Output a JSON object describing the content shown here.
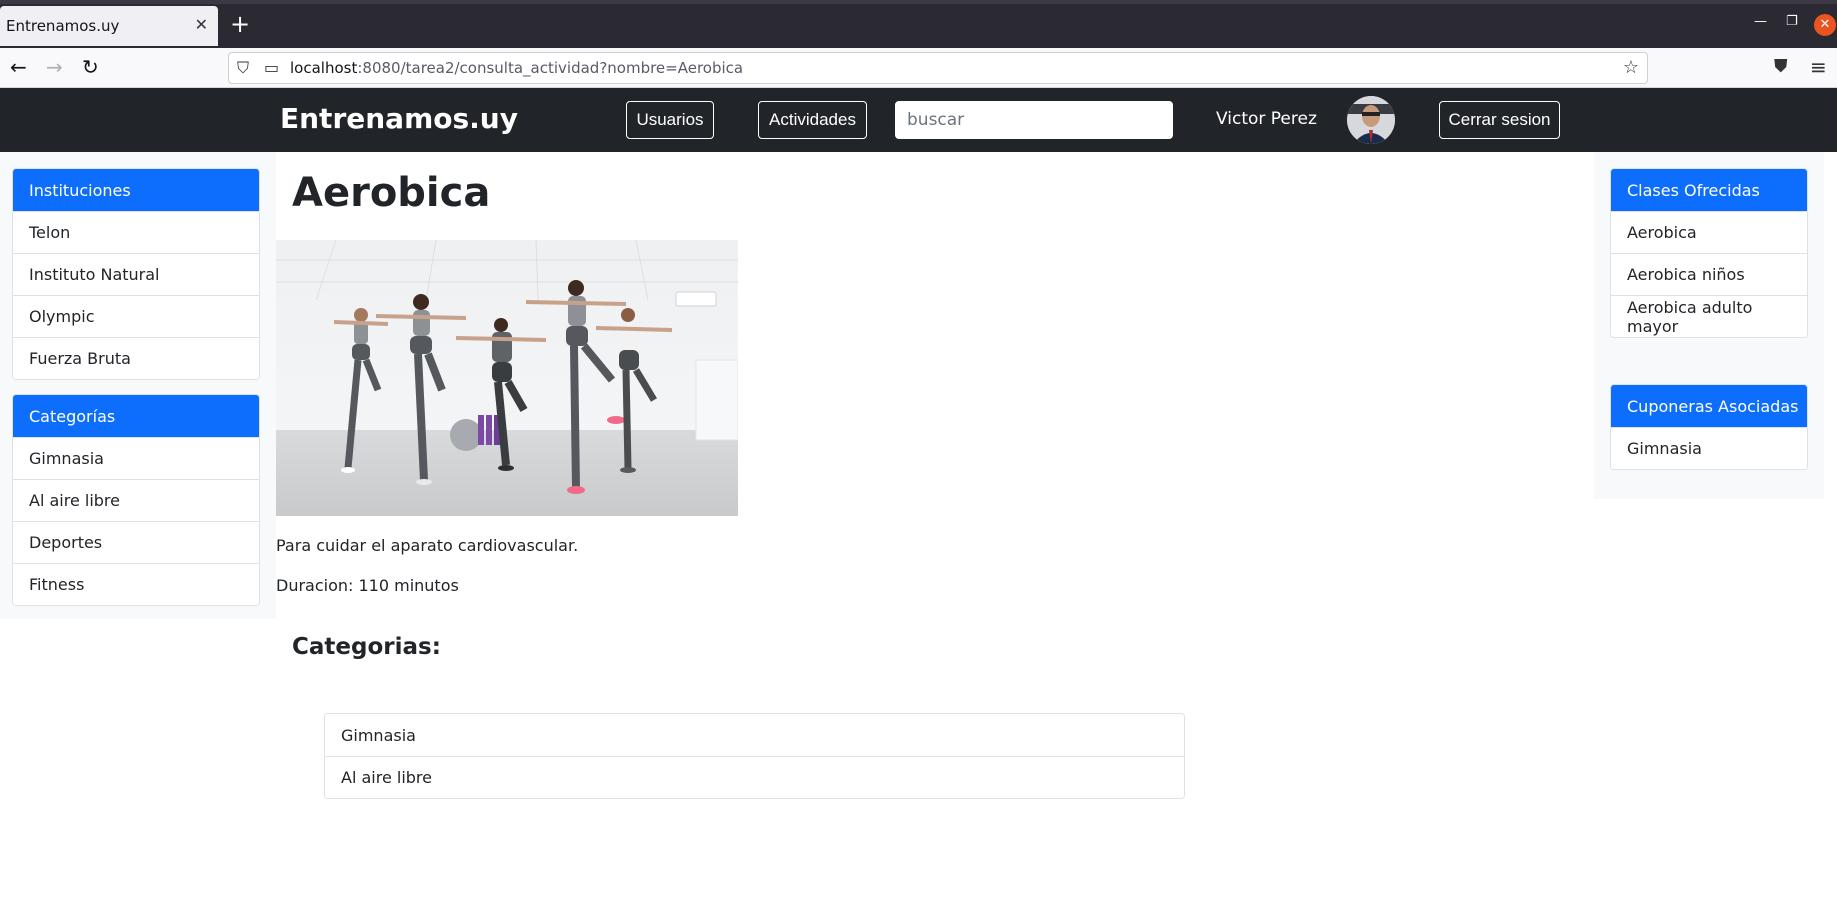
{
  "browser": {
    "tab_title": "Entrenamos.uy",
    "url_host": "localhost",
    "url_rest": ":8080/tarea2/consulta_actividad?nombre=Aerobica"
  },
  "header": {
    "brand": "Entrenamos.uy",
    "nav_usuarios": "Usuarios",
    "nav_actividades": "Actividades",
    "search_placeholder": "buscar",
    "username": "Victor Perez",
    "logout": "Cerrar sesion"
  },
  "sidebar_left": {
    "instituciones": {
      "title": "Instituciones",
      "items": [
        "Telon",
        "Instituto Natural",
        "Olympic",
        "Fuerza Bruta"
      ]
    },
    "categorias": {
      "title": "Categorías",
      "items": [
        "Gimnasia",
        "Al aire libre",
        "Deportes",
        "Fitness"
      ]
    }
  },
  "sidebar_right": {
    "clases": {
      "title": "Clases Ofrecidas",
      "items": [
        "Aerobica",
        "Aerobica niños",
        "Aerobica adulto mayor"
      ]
    },
    "cuponeras": {
      "title": "Cuponeras Asociadas",
      "items": [
        "Gimnasia"
      ]
    }
  },
  "main": {
    "title": "Aerobica",
    "description": "Para cuidar el aparato cardiovascular.",
    "duration": "Duracion: 110 minutos",
    "categories_title": "Categorias:",
    "categories": [
      "Gimnasia",
      "Al aire libre"
    ]
  },
  "colors": {
    "primary": "#0d6efd",
    "header_bg": "#212529",
    "panel_bg": "#f8f9fa"
  }
}
